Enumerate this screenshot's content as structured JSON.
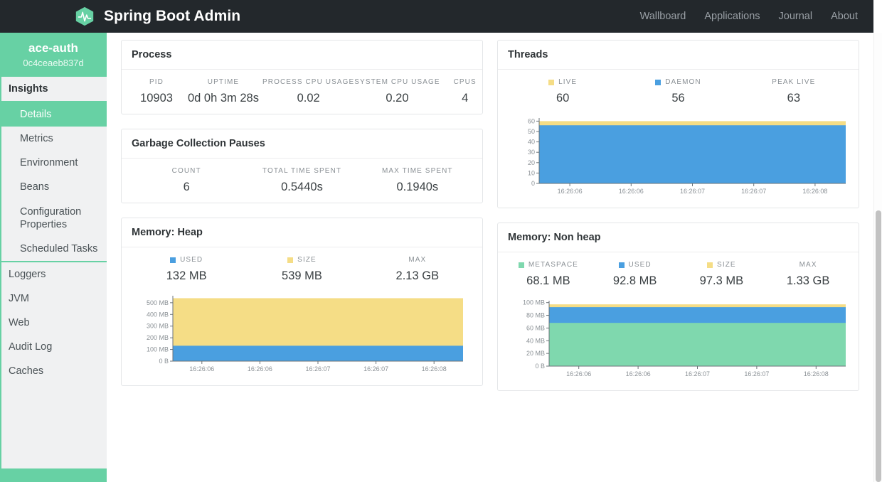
{
  "navbar": {
    "brand_title": "Spring Boot Admin",
    "logo_icon": "heartbeat-hexagon-icon",
    "links": [
      {
        "label": "Wallboard"
      },
      {
        "label": "Applications"
      },
      {
        "label": "Journal"
      },
      {
        "label": "About"
      }
    ]
  },
  "sidebar": {
    "app_name": "ace-auth",
    "app_id": "0c4ceaeb837d",
    "section_title": "Insights",
    "sub_items": [
      {
        "label": "Details",
        "active": true
      },
      {
        "label": "Metrics",
        "active": false
      },
      {
        "label": "Environment",
        "active": false
      },
      {
        "label": "Beans",
        "active": false
      },
      {
        "label": "Configuration Properties",
        "active": false
      },
      {
        "label": "Scheduled Tasks",
        "active": false
      }
    ],
    "items": [
      {
        "label": "Loggers"
      },
      {
        "label": "JVM"
      },
      {
        "label": "Web"
      },
      {
        "label": "Audit Log"
      },
      {
        "label": "Caches"
      }
    ]
  },
  "colors": {
    "accent_green": "#67d1a4",
    "series_blue": "#4a9fe0",
    "series_yellow": "#f5dd86",
    "series_green": "#7fd8ae",
    "navbar_dark": "#23282c"
  },
  "cards": {
    "process": {
      "title": "Process",
      "stats": [
        {
          "label": "PID",
          "value": "10903"
        },
        {
          "label": "Uptime",
          "value": "0d 0h 3m 28s"
        },
        {
          "label": "Process CPU Usage",
          "value": "0.02"
        },
        {
          "label": "System CPU Usage",
          "value": "0.20"
        },
        {
          "label": "CPUs",
          "value": "4"
        }
      ]
    },
    "gc": {
      "title": "Garbage Collection Pauses",
      "stats": [
        {
          "label": "Count",
          "value": "6"
        },
        {
          "label": "Total Time Spent",
          "value": "0.5440s"
        },
        {
          "label": "Max Time Spent",
          "value": "0.1940s"
        }
      ]
    },
    "threads": {
      "title": "Threads",
      "stats": [
        {
          "label": "Live",
          "value": "60",
          "color": "#f5dd86"
        },
        {
          "label": "Daemon",
          "value": "56",
          "color": "#4a9fe0"
        },
        {
          "label": "Peak Live",
          "value": "63",
          "color": null
        }
      ]
    },
    "heap": {
      "title": "Memory: Heap",
      "stats": [
        {
          "label": "Used",
          "value": "132 MB",
          "color": "#4a9fe0"
        },
        {
          "label": "Size",
          "value": "539 MB",
          "color": "#f5dd86"
        },
        {
          "label": "Max",
          "value": "2.13 GB",
          "color": null
        }
      ]
    },
    "nonheap": {
      "title": "Memory: Non heap",
      "stats": [
        {
          "label": "Metaspace",
          "value": "68.1 MB",
          "color": "#7fd8ae"
        },
        {
          "label": "Used",
          "value": "92.8 MB",
          "color": "#4a9fe0"
        },
        {
          "label": "Size",
          "value": "97.3 MB",
          "color": "#f5dd86"
        },
        {
          "label": "Max",
          "value": "1.33 GB",
          "color": null
        }
      ]
    }
  },
  "chart_data": [
    {
      "id": "threads-chart",
      "type": "area",
      "title": "Threads",
      "xlabel": "",
      "ylabel": "",
      "ylim": [
        0,
        63
      ],
      "yticks": [
        0,
        10,
        20,
        30,
        40,
        50,
        60
      ],
      "ytick_labels": [
        "0",
        "10",
        "20",
        "30",
        "40",
        "50",
        "60"
      ],
      "x": [
        "16:26:06",
        "16:26:06",
        "16:26:07",
        "16:26:07",
        "16:26:08"
      ],
      "xtick_labels": [
        "16:26:06",
        "16:26:06",
        "16:26:07",
        "16:26:07",
        "16:26:08"
      ],
      "grid": false,
      "legend_position": "top",
      "series": [
        {
          "name": "Live",
          "color": "#f5dd86",
          "values": [
            60,
            60,
            60,
            60,
            60
          ]
        },
        {
          "name": "Daemon",
          "color": "#4a9fe0",
          "values": [
            56,
            56,
            56,
            56,
            56
          ]
        }
      ]
    },
    {
      "id": "heap-chart",
      "type": "area",
      "title": "Memory: Heap",
      "xlabel": "",
      "ylabel": "",
      "ylim": [
        0,
        560
      ],
      "yticks": [
        0,
        100,
        200,
        300,
        400,
        500
      ],
      "ytick_labels": [
        "0 B",
        "100 MB",
        "200 MB",
        "300 MB",
        "400 MB",
        "500 MB"
      ],
      "x": [
        "16:26:06",
        "16:26:06",
        "16:26:07",
        "16:26:07",
        "16:26:08"
      ],
      "xtick_labels": [
        "16:26:06",
        "16:26:06",
        "16:26:07",
        "16:26:07",
        "16:26:08"
      ],
      "grid": false,
      "legend_position": "top",
      "series": [
        {
          "name": "Size",
          "color": "#f5dd86",
          "values": [
            539,
            539,
            539,
            539,
            539
          ]
        },
        {
          "name": "Used",
          "color": "#4a9fe0",
          "values": [
            132,
            132,
            132,
            132,
            132
          ]
        }
      ]
    },
    {
      "id": "nonheap-chart",
      "type": "area",
      "title": "Memory: Non heap",
      "xlabel": "",
      "ylabel": "",
      "ylim": [
        0,
        103
      ],
      "yticks": [
        0,
        20,
        40,
        60,
        80,
        100
      ],
      "ytick_labels": [
        "0 B",
        "20 MB",
        "40 MB",
        "60 MB",
        "80 MB",
        "100 MB"
      ],
      "x": [
        "16:26:06",
        "16:26:06",
        "16:26:07",
        "16:26:07",
        "16:26:08"
      ],
      "xtick_labels": [
        "16:26:06",
        "16:26:06",
        "16:26:07",
        "16:26:07",
        "16:26:08"
      ],
      "grid": false,
      "legend_position": "top",
      "series": [
        {
          "name": "Size",
          "color": "#f5dd86",
          "values": [
            97.3,
            97.3,
            97.3,
            97.3,
            97.3
          ]
        },
        {
          "name": "Used",
          "color": "#4a9fe0",
          "values": [
            92.8,
            92.8,
            92.8,
            92.8,
            92.8
          ]
        },
        {
          "name": "Metaspace",
          "color": "#7fd8ae",
          "values": [
            68.1,
            68.1,
            68.1,
            68.1,
            68.1
          ]
        }
      ]
    }
  ]
}
